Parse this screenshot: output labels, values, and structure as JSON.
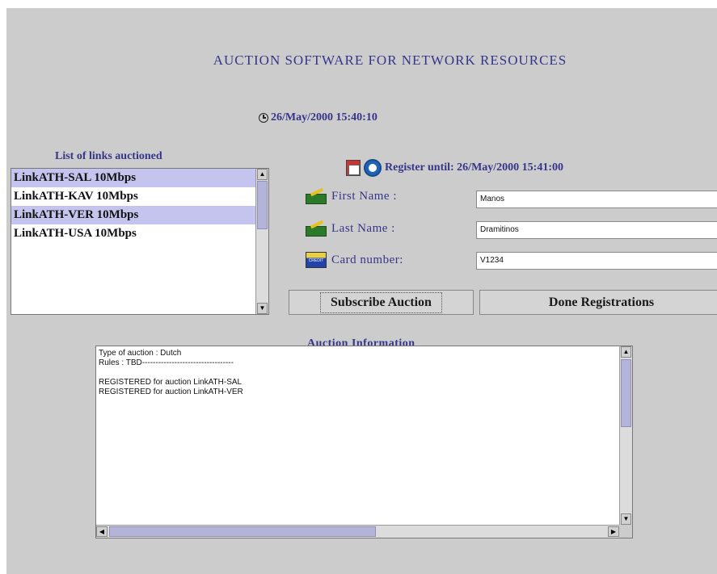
{
  "app": {
    "title": "AUCTION SOFTWARE FOR NETWORK RESOURCES",
    "current_time": "26/May/2000 15:40:10"
  },
  "links": {
    "heading": "List of links auctioned",
    "items": [
      {
        "label": "LinkATH-SAL 10Mbps",
        "selected": true
      },
      {
        "label": "LinkATH-KAV 10Mbps",
        "selected": false
      },
      {
        "label": "LinkATH-VER 10Mbps",
        "selected": true
      },
      {
        "label": "LinkATH-USA 10Mbps",
        "selected": false
      }
    ]
  },
  "registration": {
    "register_until": "Register until: 26/May/2000 15:41:00",
    "first_name_label": "First Name :",
    "first_name_value": "Manos",
    "last_name_label": "Last Name :",
    "last_name_value": "Dramitinos",
    "card_label": "Card number:",
    "card_value": "V1234",
    "card_icon_text": "CREDIT"
  },
  "buttons": {
    "subscribe": "Subscribe Auction",
    "done": "Done Registrations"
  },
  "info": {
    "heading": "Auction Information",
    "text": "Type of auction : Dutch\nRules : TBD----------------------------------\n\nREGISTERED for auction LinkATH-SAL\nREGISTERED for auction LinkATH-VER"
  },
  "icons": {
    "clock": "clock-icon",
    "calendar": "calendar-icon",
    "alarm": "alarm-clock-icon",
    "pencil": "pencil-icon",
    "card": "credit-card-icon"
  },
  "colors": {
    "panel": "#cccccc",
    "label_text": "#35358a",
    "selection": "#c4c4ee"
  }
}
